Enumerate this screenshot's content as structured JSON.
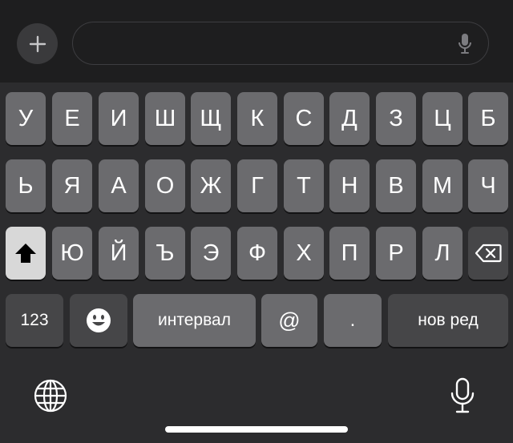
{
  "input_bar": {
    "add_icon": "plus-icon",
    "field_value": "",
    "field_placeholder": "",
    "mic_icon": "microphone-icon"
  },
  "keyboard": {
    "row1": [
      "У",
      "Е",
      "И",
      "Ш",
      "Щ",
      "К",
      "С",
      "Д",
      "З",
      "Ц",
      "Б"
    ],
    "row2": [
      "Ь",
      "Я",
      "А",
      "О",
      "Ж",
      "Г",
      "Т",
      "Н",
      "В",
      "М",
      "Ч"
    ],
    "row3": [
      "Ю",
      "Й",
      "Ъ",
      "Э",
      "Ф",
      "Х",
      "П",
      "Р",
      "Л"
    ],
    "shift_icon": "shift-arrow-icon",
    "backspace_icon": "backspace-icon",
    "numbers_label": "123",
    "emoji_icon": "emoji-icon",
    "space_label": "интервал",
    "at_label": "@",
    "dot_label": ".",
    "return_label": "нов ред",
    "globe_icon": "globe-icon",
    "dictation_icon": "microphone-icon"
  },
  "colors": {
    "keyboard_bg": "#2c2c2e",
    "input_bar_bg": "#1e1e1f",
    "letter_key": "#6b6b6e",
    "function_key": "#464648",
    "shift_active": "#d8d8d8",
    "text": "#ffffff"
  }
}
